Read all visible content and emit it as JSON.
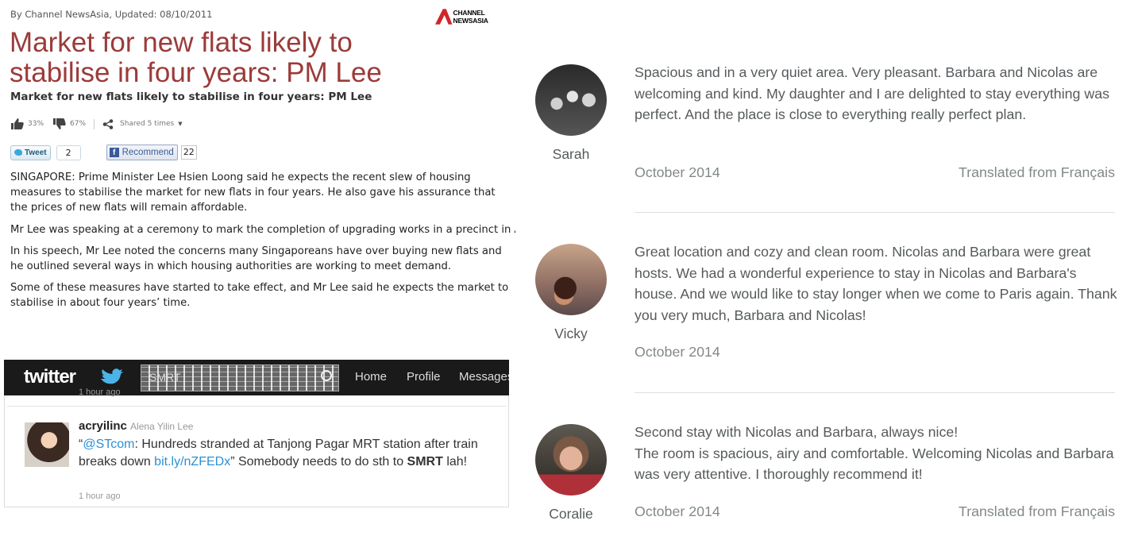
{
  "article": {
    "byline": "By Channel NewsAsia, Updated: 08/10/2011",
    "logo_text": "CHANNEL NEWSASIA",
    "headline_line1": "Market for new flats likely to",
    "headline_line2": "stabilise in four years: PM Lee",
    "subheadline": "Market for new flats likely to stabilise in four years: PM Lee",
    "like_pct": "33%",
    "dislike_pct": "67%",
    "shared": "Shared 5 times",
    "tweet_label": "Tweet",
    "tweet_count": "2",
    "recommend_label": "Recommend",
    "recommend_count": "22",
    "paragraphs": [
      "SINGAPORE: Prime Minister Lee Hsien Loong said he expects the recent slew of housing measures to stabilise the market for new flats in four years. He also gave his assurance that the prices of new flats will remain affordable.",
      "Mr Lee was speaking at a ceremony to mark the completion of upgrading works in a precinct in Ang Mo Kio.",
      "In his speech, Mr Lee noted the concerns many Singaporeans have over buying new flats and he outlined several ways in which housing authorities are working to meet demand.",
      "Some of these measures have started to take effect, and Mr Lee said he expects the market to stabilise in about four years’ time."
    ]
  },
  "twitter": {
    "logo": "twitter",
    "search_text": "SMRT",
    "nav": [
      "Home",
      "Profile",
      "Messages"
    ],
    "time_top": "1 hour ago",
    "tweet": {
      "username": "acryilinc",
      "fullname": "Alena Yilin Lee",
      "quote_open": "“",
      "mention": "@STcom",
      "text1": ": Hundreds stranded at Tanjong Pagar MRT station after train breaks down ",
      "link": "bit.ly/nZFEDx",
      "text2": "” Somebody needs to do sth to ",
      "bold": "SMRT",
      "text3": " lah!",
      "time": "1 hour ago"
    }
  },
  "reviews": [
    {
      "name": "Sarah",
      "text": "Spacious and in a very quiet area. Very pleasant. Barbara and Nicolas are welcoming and kind. My daughter and I are delighted to stay everything was perfect. And the place is close to everything really perfect plan.",
      "date": "October 2014",
      "translated": "Translated from Français"
    },
    {
      "name": "Vicky",
      "text": "Great location and cozy and clean room. Nicolas and Barbara were great hosts. We had a wonderful experience to stay in Nicolas and Barbara's house. And we would like to stay longer when we come to Paris again. Thank you very much, Barbara and Nicolas!",
      "date": "October 2014",
      "translated": ""
    },
    {
      "name": "Coralie",
      "text_line1": "Second stay with Nicolas and Barbara, always nice!",
      "text": "The room is spacious, airy and comfortable. Welcoming Nicolas and Barbara was very attentive. I thoroughly recommend it!",
      "date": "October 2014",
      "translated": "Translated from Français"
    }
  ],
  "colors": {
    "headline": "#9b3b3a",
    "review_text": "#565a5c",
    "twitter_link": "#2c8fd4",
    "twitter_bar": "#1a1a1a"
  }
}
